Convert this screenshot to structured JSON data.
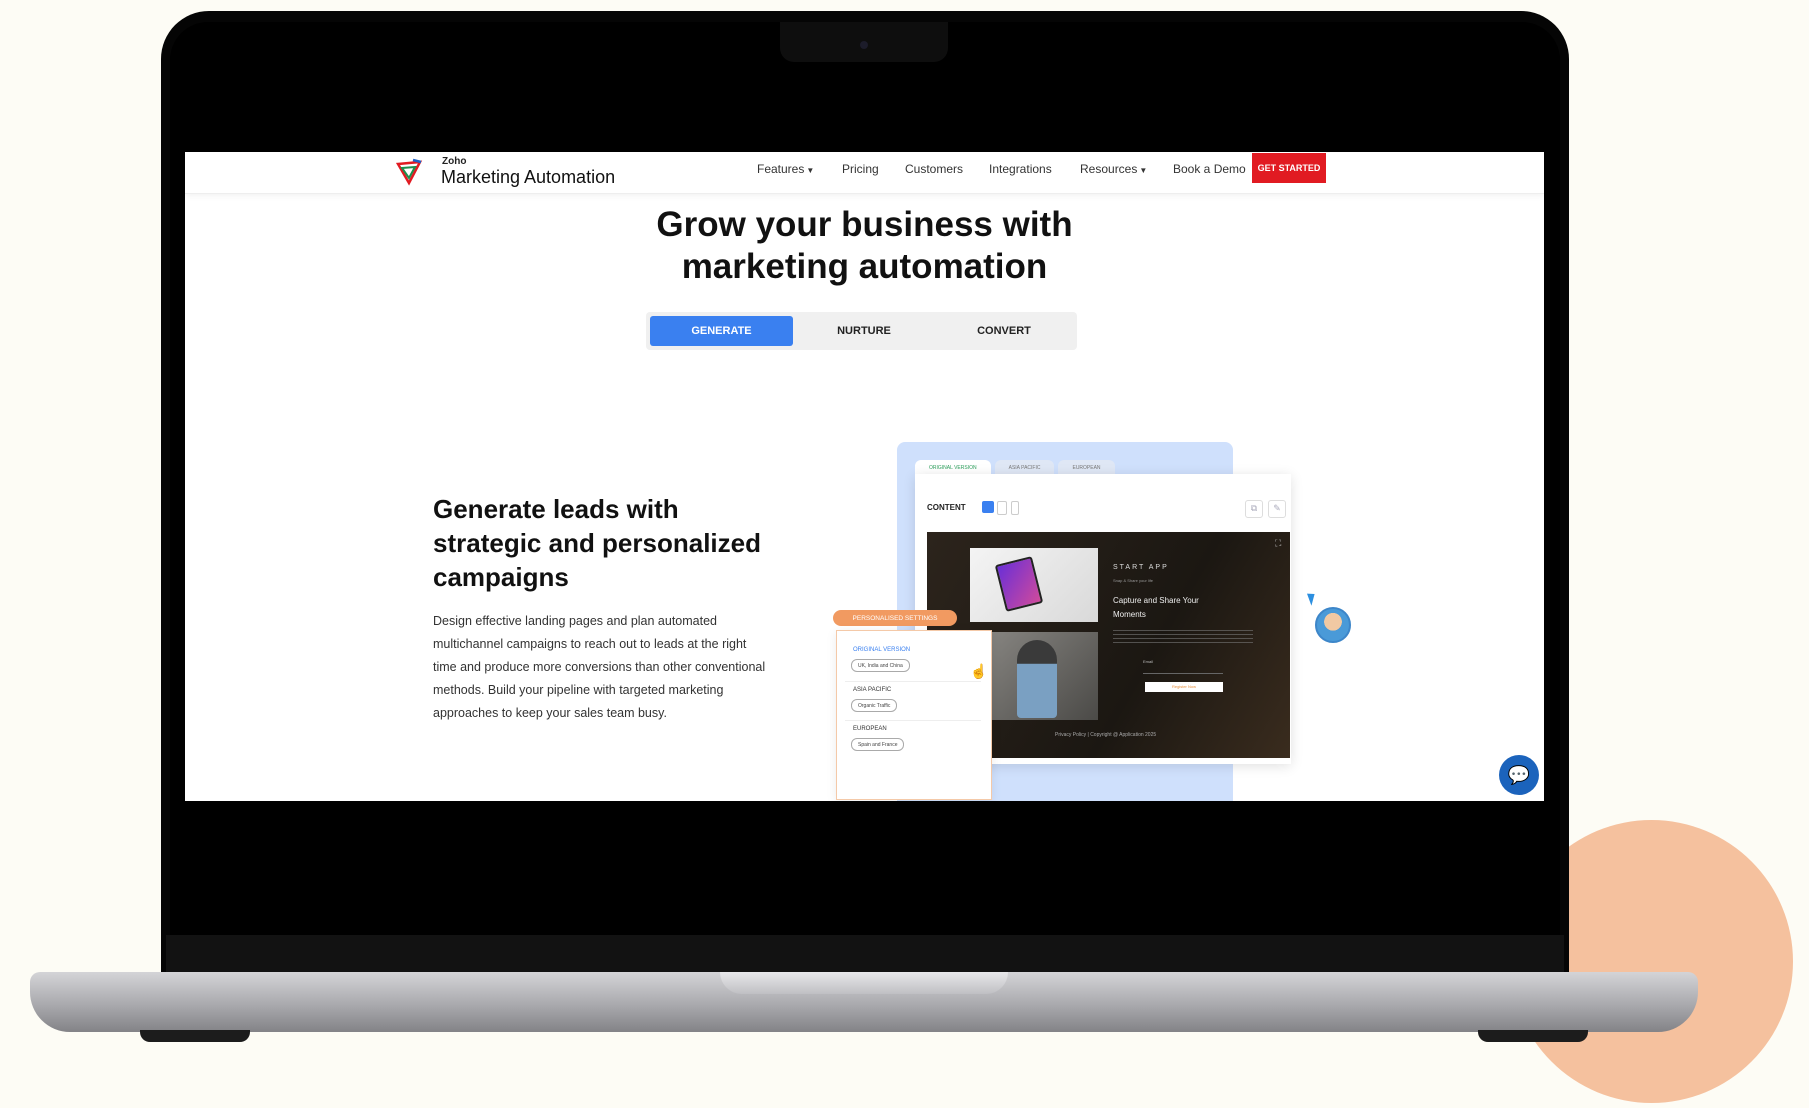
{
  "brand": {
    "company": "Zoho",
    "product": "Marketing Automation"
  },
  "nav": {
    "items": [
      "Features",
      "Pricing",
      "Customers",
      "Integrations",
      "Resources",
      "Book a Demo"
    ],
    "cta": "GET STARTED"
  },
  "hero": {
    "title_line1": "Grow your business with",
    "title_line2": "marketing automation"
  },
  "tabs": [
    "GENERATE",
    "NURTURE",
    "CONVERT"
  ],
  "section": {
    "title": "Generate leads with strategic and personalized campaigns",
    "body": "Design effective landing pages and plan automated multichannel campaigns to reach out to leads at the right time and produce more conversions than other conventional methods. Build your pipeline with targeted marketing approaches to keep your sales team busy."
  },
  "mockup": {
    "tabs": [
      "ORIGINAL VERSION",
      "ASIA PACIFIC",
      "EUROPEAN"
    ],
    "content_label": "CONTENT",
    "page": {
      "app_name": "START APP",
      "tagline": "Snap & Share your life",
      "headline": "Capture and Share Your Moments",
      "email_label": "Email",
      "button": "Register Now",
      "footer": "Privacy Policy | Copyright @ Application 2025"
    },
    "personalised": {
      "badge": "PERSONALISED SETTINGS",
      "groups": [
        {
          "title": "ORIGINAL VERSION",
          "pill": "UK, India and China"
        },
        {
          "title": "ASIA PACIFIC",
          "pill": "Organic Traffic"
        },
        {
          "title": "EUROPEAN",
          "pill": "Spain and France"
        }
      ]
    }
  },
  "colors": {
    "cta": "#e11b22",
    "tab_active": "#3a80f0",
    "badge": "#f19a61",
    "chat": "#1b63bc",
    "decor_circle": "#f5c19e"
  },
  "icons": [
    "zoho-logo-icon",
    "caret-down-icon",
    "desktop-icon",
    "tablet-icon",
    "mobile-icon",
    "share-icon",
    "edit-icon",
    "expand-icon",
    "hand-pointer-icon",
    "cursor-icon",
    "chat-icon"
  ]
}
